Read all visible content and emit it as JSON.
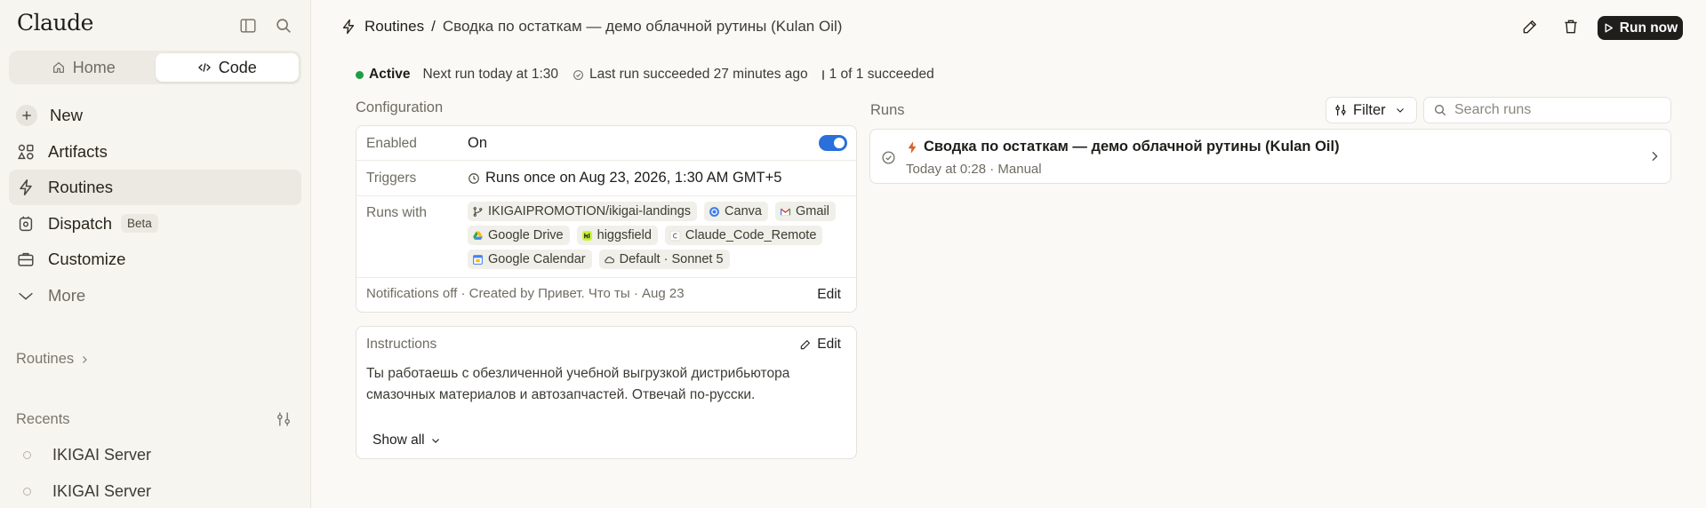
{
  "sidebar": {
    "brand": "Claude",
    "modes": [
      {
        "label": "Home",
        "active": false
      },
      {
        "label": "Code",
        "active": true
      }
    ],
    "nav": [
      {
        "label": "New",
        "icon": "plus-icon"
      },
      {
        "label": "Artifacts",
        "icon": "artifacts-icon"
      },
      {
        "label": "Routines",
        "icon": "bolt-icon",
        "active": true
      },
      {
        "label": "Dispatch",
        "icon": "dispatch-icon",
        "badge": "Beta"
      },
      {
        "label": "Customize",
        "icon": "briefcase-icon"
      },
      {
        "label": "More",
        "icon": "chevron-down-icon"
      }
    ],
    "routines_label": "Routines",
    "recents_label": "Recents",
    "recents": [
      "IKIGAI Server",
      "IKIGAI Server"
    ]
  },
  "header": {
    "crumb_root": "Routines",
    "crumb_sep": "/",
    "crumb_current": "Сводка по остаткам — демо облачной рутины (Kulan Oil)",
    "run_now": "Run now"
  },
  "status": {
    "active": "Active",
    "next_run": "Next run today at 1:30",
    "last_run": "Last run succeeded 27 minutes ago",
    "succeeded": "1 of 1 succeeded",
    "active_color": "#1f9d45"
  },
  "config": {
    "title": "Configuration",
    "enabled_label": "Enabled",
    "enabled_value": "On",
    "triggers_label": "Triggers",
    "triggers_value": "Runs once on Aug 23, 2026, 1:30 AM GMT+5",
    "runs_with_label": "Runs with",
    "chips": [
      {
        "label": "IKIGAIPROMOTION/ikigai-landings",
        "icon": "git-branch-icon"
      },
      {
        "label": "Canva",
        "icon": "canva-icon"
      },
      {
        "label": "Gmail",
        "icon": "gmail-icon"
      },
      {
        "label": "Google Drive",
        "icon": "google-drive-icon"
      },
      {
        "label": "higgsfield",
        "icon": "higgsfield-icon"
      },
      {
        "label": "Claude_Code_Remote",
        "icon": "letter-c-icon"
      },
      {
        "label": "Google Calendar",
        "icon": "google-calendar-icon"
      },
      {
        "label": "Default · Sonnet 5",
        "icon": "cloud-icon"
      }
    ],
    "footer": "Notifications off · Created by Привет. Что ты · Aug 23",
    "edit": "Edit",
    "toggle_color": "#2a6fdb"
  },
  "instructions": {
    "title": "Instructions",
    "edit": "Edit",
    "text": "Ты работаешь с обезличенной учебной выгрузкой дистрибьютора смазочных материалов и автозапчастей. Отвечай по-русски.",
    "show_all": "Show all"
  },
  "runs": {
    "title": "Runs",
    "filter": "Filter",
    "search_placeholder": "Search runs",
    "items": [
      {
        "title": "Сводка по остаткам — демо облачной рутины (Kulan Oil)",
        "meta": "Today at 0:28 · Manual",
        "accent": "#d9622b"
      }
    ]
  }
}
